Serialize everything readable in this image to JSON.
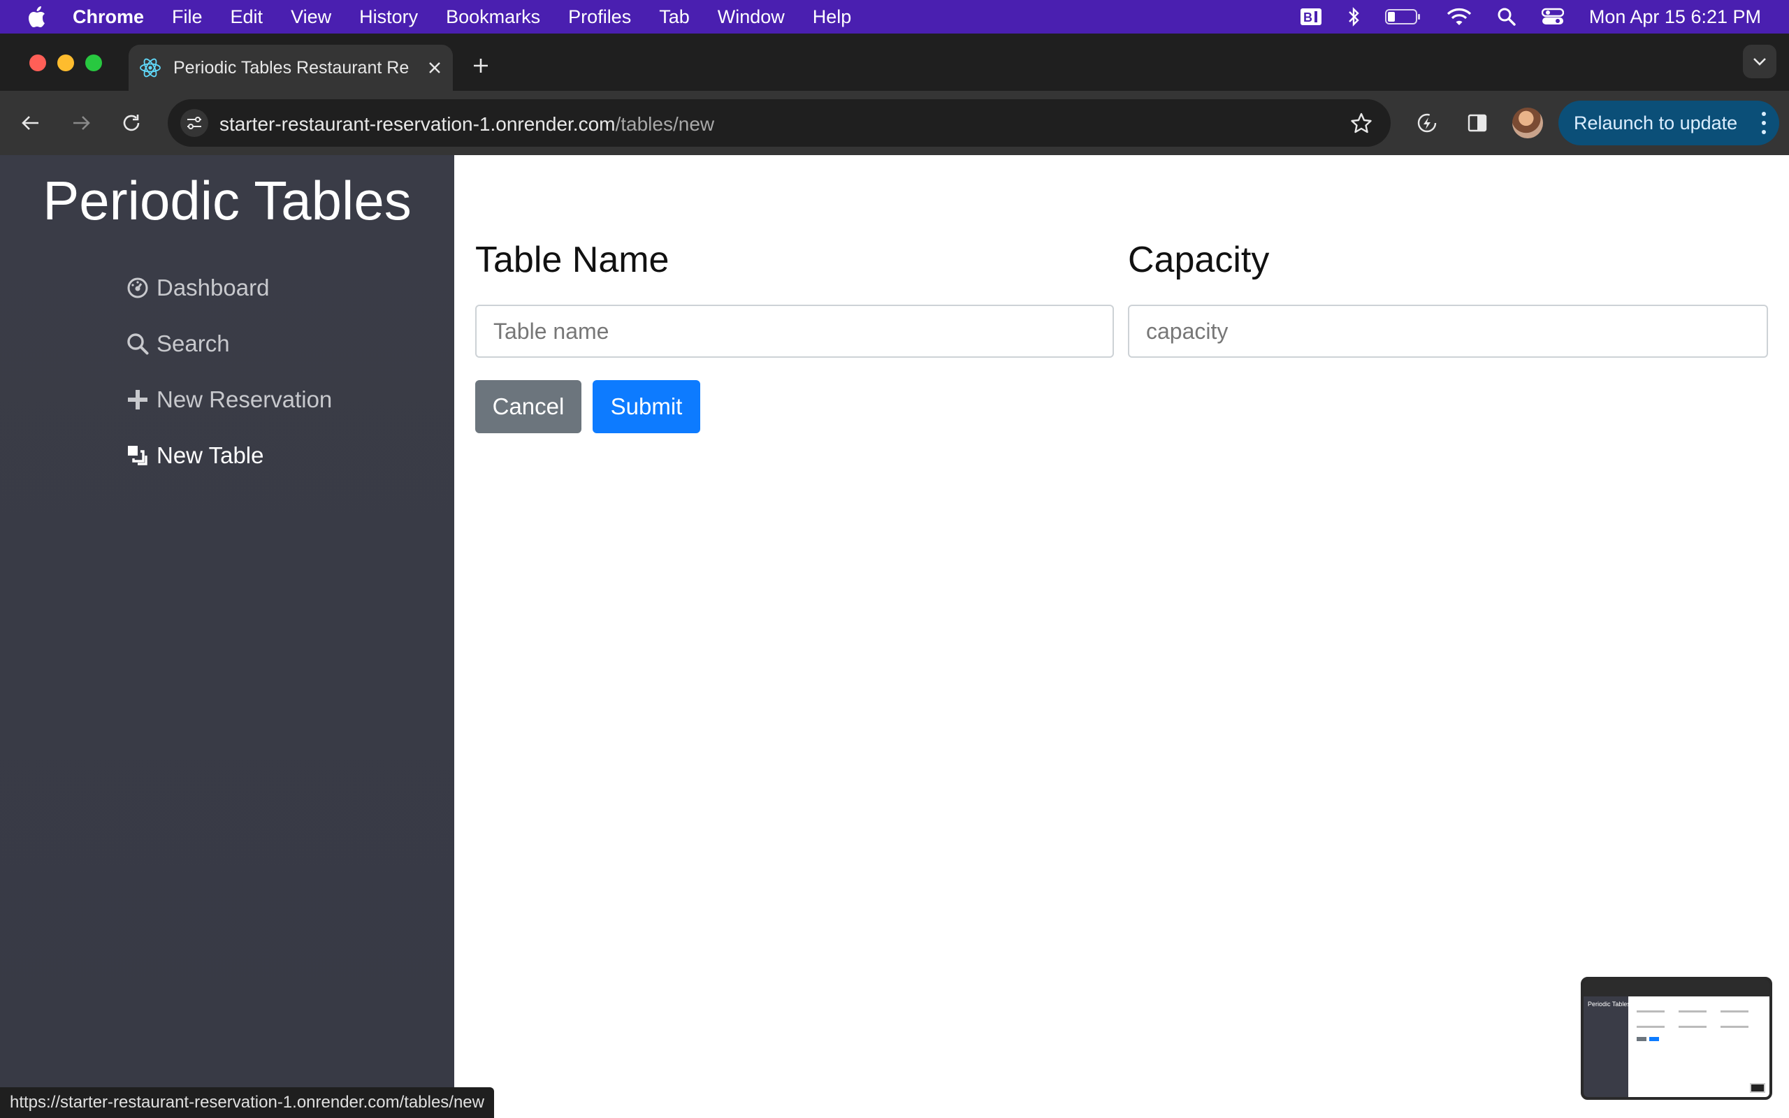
{
  "menubar": {
    "app_name": "Chrome",
    "items": [
      "File",
      "Edit",
      "View",
      "History",
      "Bookmarks",
      "Profiles",
      "Tab",
      "Window",
      "Help"
    ],
    "clock": "Mon Apr 15  6:21 PM",
    "status_icons": [
      "bl-app-icon",
      "bluetooth-icon",
      "battery-icon",
      "wifi-icon",
      "spotlight-search-icon",
      "control-center-icon"
    ]
  },
  "browser": {
    "tab_title": "Periodic Tables Restaurant Re",
    "url_host": "starter-restaurant-reservation-1.onrender.com",
    "url_path": "/tables/new",
    "relaunch_label": "Relaunch to update",
    "status_url": "https://starter-restaurant-reservation-1.onrender.com/tables/new"
  },
  "sidebar": {
    "brand": "Periodic Tables",
    "items": [
      {
        "label": "Dashboard",
        "icon": "dashboard-icon"
      },
      {
        "label": "Search",
        "icon": "search-icon"
      },
      {
        "label": "New Reservation",
        "icon": "plus-icon"
      },
      {
        "label": "New Table",
        "icon": "layers-icon"
      }
    ]
  },
  "form": {
    "table_name_label": "Table Name",
    "table_name_placeholder": "Table name",
    "table_name_value": "",
    "capacity_label": "Capacity",
    "capacity_placeholder": "capacity",
    "capacity_value": "",
    "cancel_label": "Cancel",
    "submit_label": "Submit"
  },
  "thumbnail": {
    "brand": "Periodic Tables"
  },
  "colors": {
    "menubar_bg": "#4a1fb0",
    "sidebar_bg": "#3a3c47",
    "cancel_bg": "#6c757d",
    "submit_bg": "#0d7bff",
    "relaunch_bg": "#0b4f78"
  }
}
